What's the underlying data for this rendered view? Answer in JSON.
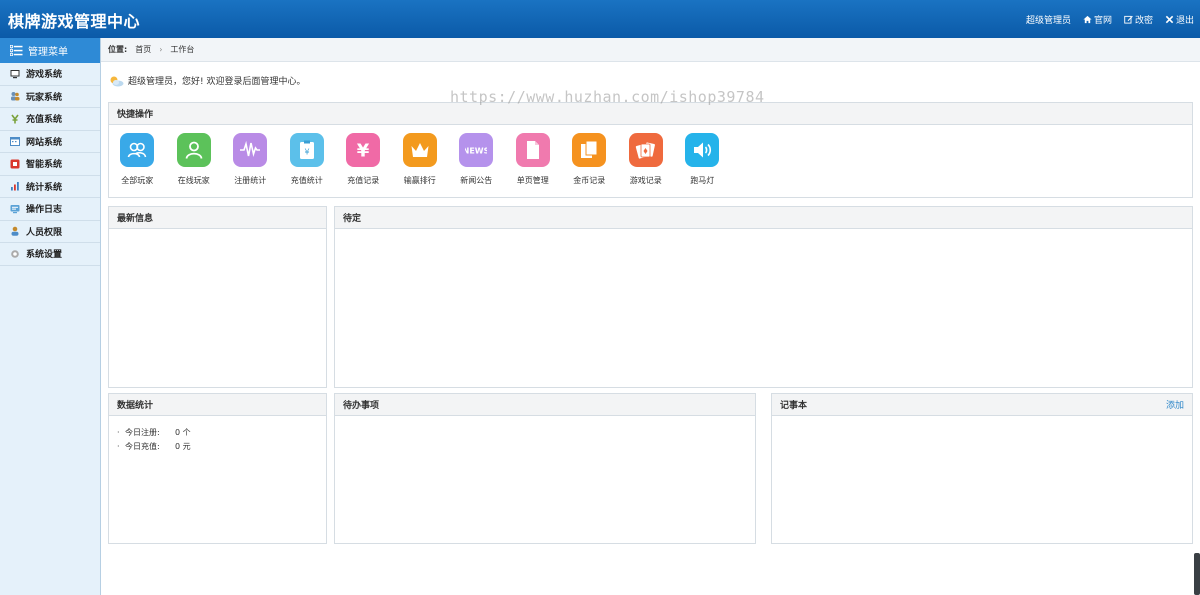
{
  "header": {
    "title": "棋牌游戏管理中心",
    "user": "超级管理员",
    "site_label": "官网",
    "password_label": "改密",
    "logout_label": "退出"
  },
  "sidebar": {
    "title": "管理菜单",
    "items": [
      {
        "label": "游戏系统",
        "icon": "monitor-icon",
        "color": "#3a3a3a"
      },
      {
        "label": "玩家系统",
        "icon": "users-icon",
        "color": "#6a8fb5"
      },
      {
        "label": "充值系统",
        "icon": "money-icon",
        "color": "#7aa23c"
      },
      {
        "label": "网站系统",
        "icon": "calendar-icon",
        "color": "#4d8cc7"
      },
      {
        "label": "智能系统",
        "icon": "chip-icon",
        "color": "#d9362c"
      },
      {
        "label": "统计系统",
        "icon": "bar-chart-icon",
        "color": "#3f7fc1"
      },
      {
        "label": "操作日志",
        "icon": "log-icon",
        "color": "#5aa2d6"
      },
      {
        "label": "人员权限",
        "icon": "person-icon",
        "color": "#c48a2d"
      },
      {
        "label": "系统设置",
        "icon": "gear-icon",
        "color": "#888888"
      }
    ]
  },
  "breadcrumb": {
    "position_label": "位置:",
    "home": "首页",
    "current": "工作台"
  },
  "welcome": "超级管理员，您好! 欢迎登录后面管理中心。",
  "watermark": "https://www.huzhan.com/ishop39784",
  "quick": {
    "title": "快捷操作",
    "items": [
      {
        "label": "全部玩家",
        "icon": "users-icon",
        "color": "#39a9e8"
      },
      {
        "label": "在线玩家",
        "icon": "user-icon",
        "color": "#5cc25a"
      },
      {
        "label": "注册统计",
        "icon": "wave-icon",
        "color": "#b98be6"
      },
      {
        "label": "充值统计",
        "icon": "clipboard-icon",
        "color": "#5cc0ea"
      },
      {
        "label": "充值记录",
        "icon": "yen-icon",
        "color": "#f06aa6"
      },
      {
        "label": "输赢排行",
        "icon": "crown-icon",
        "color": "#f39a1e"
      },
      {
        "label": "新闻公告",
        "icon": "news-icon",
        "color": "#b592ec"
      },
      {
        "label": "单页管理",
        "icon": "page-icon",
        "color": "#f07aae"
      },
      {
        "label": "金币记录",
        "icon": "copy-icon",
        "color": "#f5921f"
      },
      {
        "label": "游戏记录",
        "icon": "cards-icon",
        "color": "#ef6a3e"
      },
      {
        "label": "跑马灯",
        "icon": "speaker-icon",
        "color": "#25b3ea"
      }
    ]
  },
  "panels": {
    "latest": "最新信息",
    "pending": "待定",
    "stats": "数据统计",
    "todo": "待办事项",
    "notes": "记事本",
    "notes_add": "添加"
  },
  "stats": [
    {
      "key": "今日注册:",
      "value": "0 个"
    },
    {
      "key": "今日充值:",
      "value": "0 元"
    }
  ]
}
